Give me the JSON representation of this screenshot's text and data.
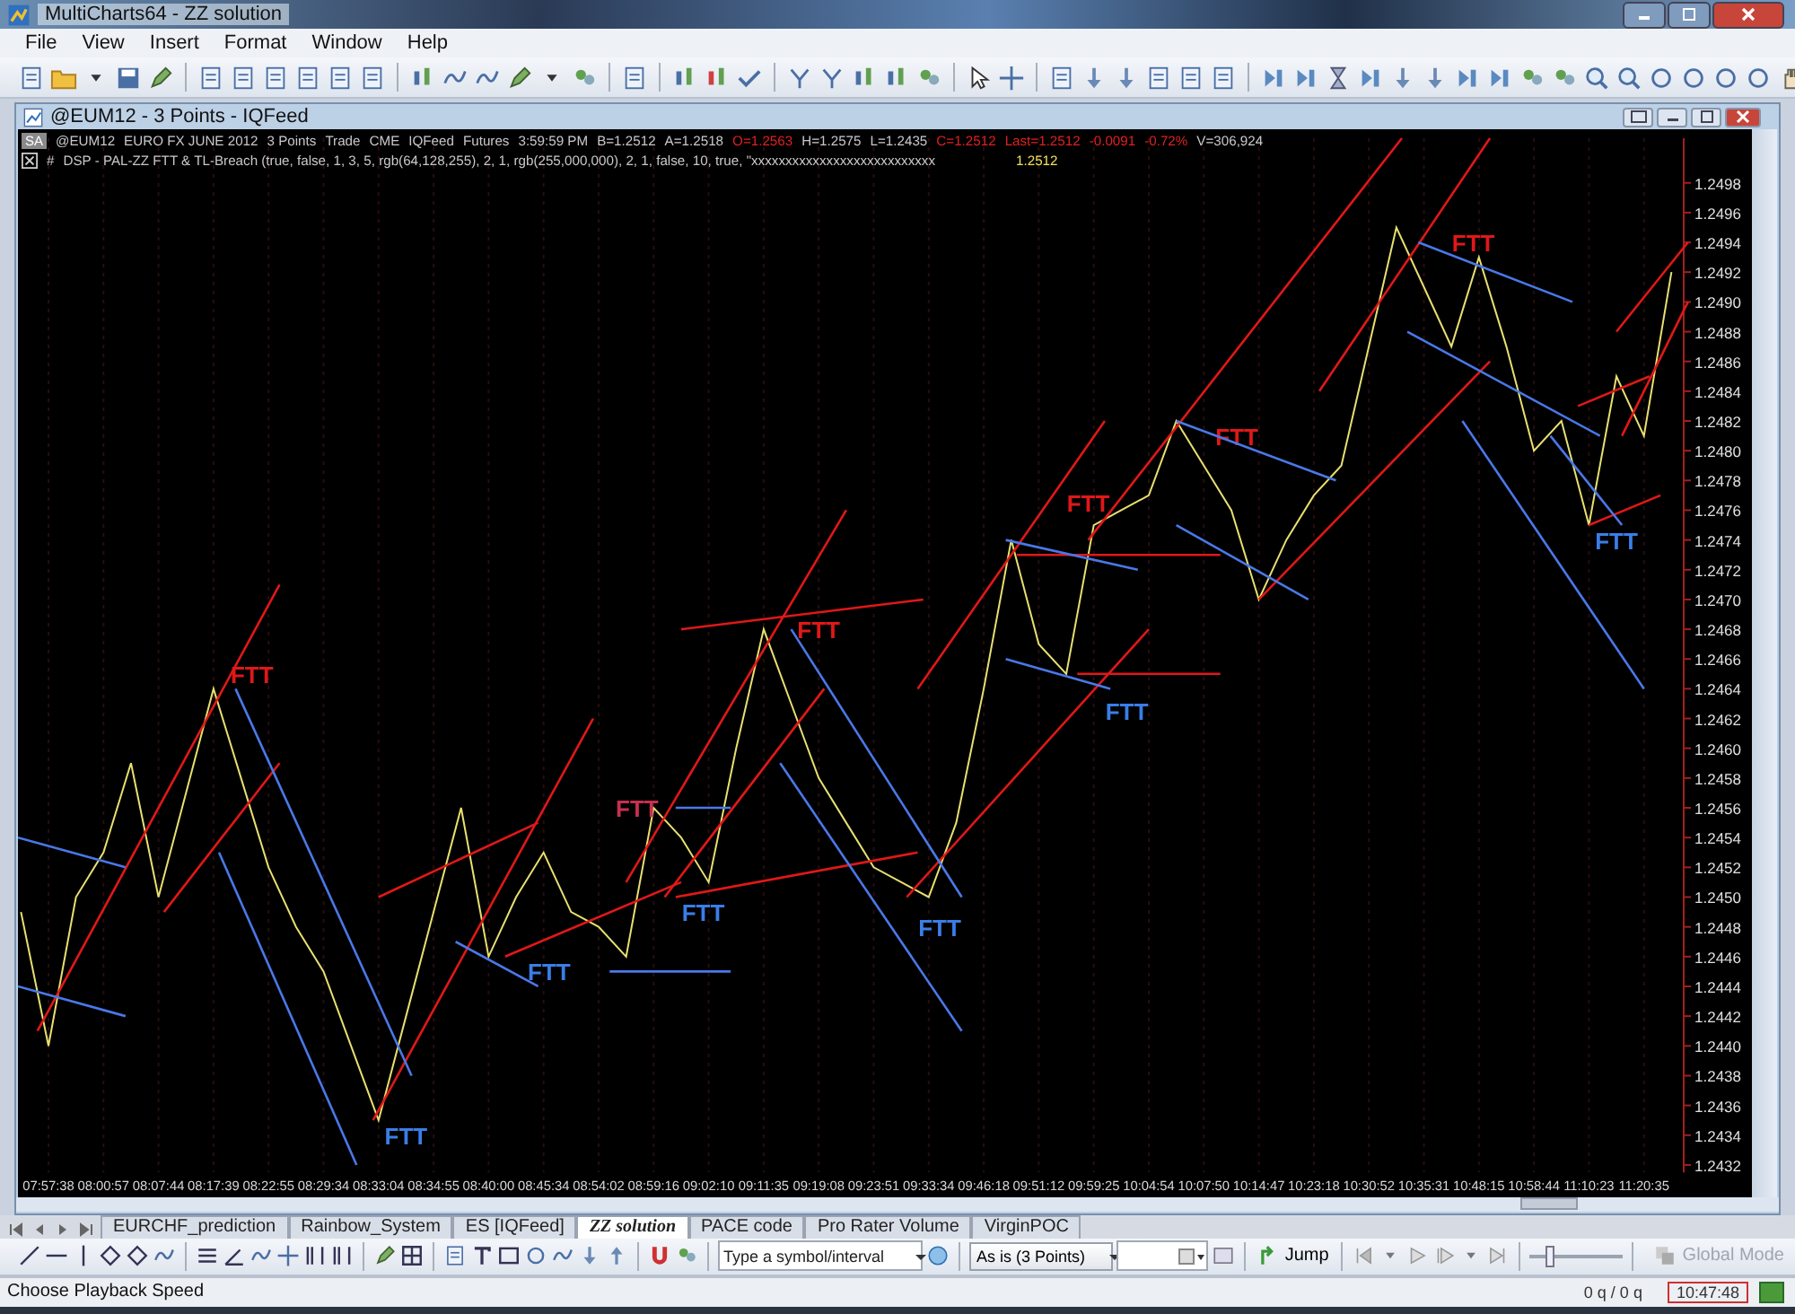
{
  "window": {
    "title": "MultiCharts64 - ZZ solution"
  },
  "menu": [
    "File",
    "View",
    "Insert",
    "Format",
    "Window",
    "Help"
  ],
  "chart_window": {
    "title": "@EUM12 - 3 Points - IQFeed",
    "status_badge": "SA",
    "symbol_info": [
      {
        "text": "@EUM12",
        "color": "#c8c8c8"
      },
      {
        "text": "EURO FX JUNE 2012",
        "color": "#c8c8c8"
      },
      {
        "text": "3 Points",
        "color": "#c8c8c8"
      },
      {
        "text": "Trade",
        "color": "#c8c8c8"
      },
      {
        "text": "CME",
        "color": "#c8c8c8"
      },
      {
        "text": "IQFeed",
        "color": "#c8c8c8"
      },
      {
        "text": "Futures",
        "color": "#c8c8c8"
      },
      {
        "text": "3:59:59 PM",
        "color": "#c8c8c8"
      },
      {
        "text": "B=1.2512",
        "color": "#c8c8c8"
      },
      {
        "text": "A=1.2518",
        "color": "#c8c8c8"
      },
      {
        "text": "O=1.2563",
        "color": "#e02020"
      },
      {
        "text": "H=1.2575",
        "color": "#c8c8c8"
      },
      {
        "text": "L=1.2435",
        "color": "#c8c8c8"
      },
      {
        "text": "C=1.2512",
        "color": "#e02020"
      },
      {
        "text": "Last=1.2512",
        "color": "#e02020"
      },
      {
        "text": "-0.0091",
        "color": "#e02020"
      },
      {
        "text": "-0.72%",
        "color": "#e02020"
      },
      {
        "text": "V=306,924",
        "color": "#c8c8c8"
      }
    ],
    "study_line": {
      "marker": "#",
      "text": "DSP - PAL-ZZ  FTT & TL-Breach  (true, false, 1, 3, 5, rgb(64,128,255), 2, 1, rgb(255,000,000), 2, 1, false, 10, true, \"xxxxxxxxxxxxxxxxxxxxxxxxxxx",
      "value": "1.2512"
    },
    "signal_labels": [
      {
        "text": "FTT",
        "color": "#e01818"
      },
      {
        "text": "FTT",
        "color": "#3a7ee8"
      },
      {
        "text": "FTT",
        "color": "#3a7ee8"
      },
      {
        "text": "FTT",
        "color": "#c83050"
      },
      {
        "text": "FTT",
        "color": "#3a7ee8"
      },
      {
        "text": "FTT",
        "color": "#e01818"
      },
      {
        "text": "FTT",
        "color": "#3a7ee8"
      },
      {
        "text": "FTT",
        "color": "#e01818"
      },
      {
        "text": "FTT",
        "color": "#3a7ee8"
      },
      {
        "text": "FTT",
        "color": "#e01818"
      },
      {
        "text": "FTT",
        "color": "#e01818"
      },
      {
        "text": "FTT",
        "color": "#3a7ee8"
      }
    ],
    "chart_data": {
      "type": "line",
      "grid": true,
      "ylim": [
        1.24315,
        1.2501
      ],
      "categories": [
        null,
        "07:57:38",
        null,
        "08:00:57",
        null,
        "08:07:44",
        null,
        "08:17:39",
        null,
        "08:22:55",
        null,
        "08:29:34",
        null,
        "08:33:04",
        null,
        "08:34:55",
        null,
        "08:40:00",
        null,
        "08:45:34",
        null,
        "08:54:02",
        null,
        "08:59:16",
        null,
        "09:02:10",
        null,
        "09:11:35",
        null,
        "09:19:08",
        null,
        "09:23:51",
        null,
        "09:33:34",
        null,
        "09:46:18",
        null,
        "09:51:12",
        null,
        "09:59:25",
        null,
        "10:04:54",
        null,
        "10:07:50",
        null,
        "10:14:47",
        null,
        "10:23:18",
        null,
        "10:30:52",
        null,
        "10:35:31",
        null,
        "10:48:15",
        null,
        "10:58:44",
        null,
        "11:10:23",
        null,
        "11:20:35",
        null
      ],
      "yticks": [
        1.2432,
        1.2434,
        1.2436,
        1.2438,
        {
          "value": 1.244,
          "label": "1.2440"
        },
        1.2442,
        1.2444,
        1.2446,
        1.2448,
        {
          "value": 1.245,
          "label": "1.2450"
        },
        1.2452,
        1.2454,
        1.2456,
        1.2458,
        {
          "value": 1.246,
          "label": "1.2460"
        },
        1.2462,
        1.2464,
        1.2466,
        1.2468,
        {
          "value": 1.247,
          "label": "1.2470"
        },
        1.2472,
        1.2474,
        1.2476,
        1.2478,
        {
          "value": 1.248,
          "label": "1.2480"
        },
        1.2482,
        1.2484,
        1.2486,
        1.2488,
        {
          "value": 1.249,
          "label": "1.2490"
        },
        1.2492,
        1.2494,
        1.2496,
        1.2498
      ],
      "series": [
        {
          "color": "#e8e070",
          "values": [
            1.2449,
            1.244,
            1.245,
            1.2453,
            1.2459,
            1.245,
            1.2457,
            1.2464,
            1.2458,
            1.2452,
            1.2448,
            1.2445,
            1.244,
            1.2435,
            1.2442,
            1.2449,
            1.2456,
            1.2446,
            1.245,
            1.2453,
            1.2449,
            1.2448,
            1.2446,
            1.2456,
            1.2454,
            1.2451,
            1.246,
            1.2468,
            1.2463,
            1.2458,
            1.2455,
            1.2452,
            1.2451,
            1.245,
            1.2455,
            1.2464,
            1.2474,
            1.2467,
            1.2465,
            1.2475,
            1.2476,
            1.2477,
            1.2482,
            1.2479,
            1.2476,
            1.247,
            1.2474,
            1.2477,
            1.2479,
            1.2487,
            1.2495,
            1.2491,
            1.2487,
            1.2493,
            1.2487,
            1.248,
            1.2482,
            1.2475,
            1.2485,
            1.2481,
            1.2492
          ]
        }
      ]
    }
  },
  "sheet_tabs": [
    {
      "label": "EURCHF_prediction",
      "selected": false
    },
    {
      "label": "Rainbow_System",
      "selected": false
    },
    {
      "label": "ES [IQFeed]",
      "selected": false
    },
    {
      "label": "ZZ solution",
      "selected": true
    },
    {
      "label": "PACE code",
      "selected": false
    },
    {
      "label": "Pro Rater Volume",
      "selected": false
    },
    {
      "label": "VirginPOC",
      "selected": false
    }
  ],
  "drawing_toolbar": {
    "symbol_field": {
      "placeholder": "Type a symbol/interval"
    },
    "resolution": "As is (3 Points)",
    "jump": "Jump",
    "playback_speed": {
      "level": 0.2
    },
    "global_mode": {
      "label": "Global Mode",
      "disabled": true
    }
  },
  "status_bar": {
    "message": "Choose Playback Speed",
    "quotes": "0 q / 0 q",
    "clock": "10:47:48"
  }
}
